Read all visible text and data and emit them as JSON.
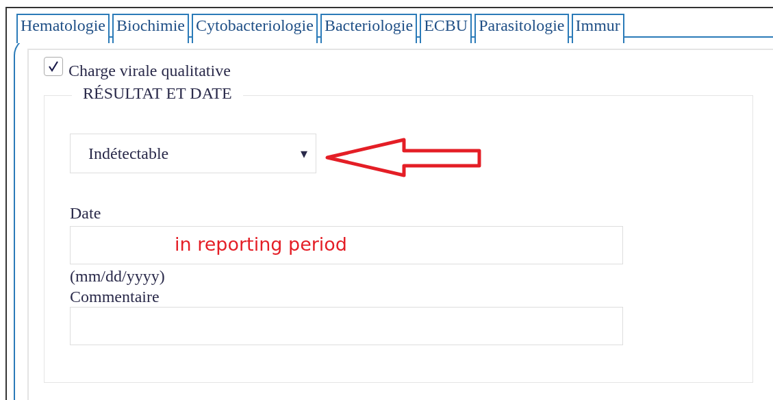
{
  "tabs": [
    {
      "label": "Hematologie"
    },
    {
      "label": "Biochimie"
    },
    {
      "label": "Cytobacteriologie"
    },
    {
      "label": "Bacteriologie"
    },
    {
      "label": "ECBU"
    },
    {
      "label": "Parasitologie"
    },
    {
      "label": "Immur"
    }
  ],
  "test": {
    "label": "Charge virale qualitative",
    "checked": true
  },
  "fieldset": {
    "legend": "RÉSULTAT ET DATE",
    "result": {
      "value": "Indétectable",
      "caret": "▾"
    },
    "date": {
      "label": "Date",
      "annotation": "in reporting period",
      "hint": "(mm/dd/yyyy)"
    },
    "comment": {
      "label": "Commentaire"
    }
  }
}
